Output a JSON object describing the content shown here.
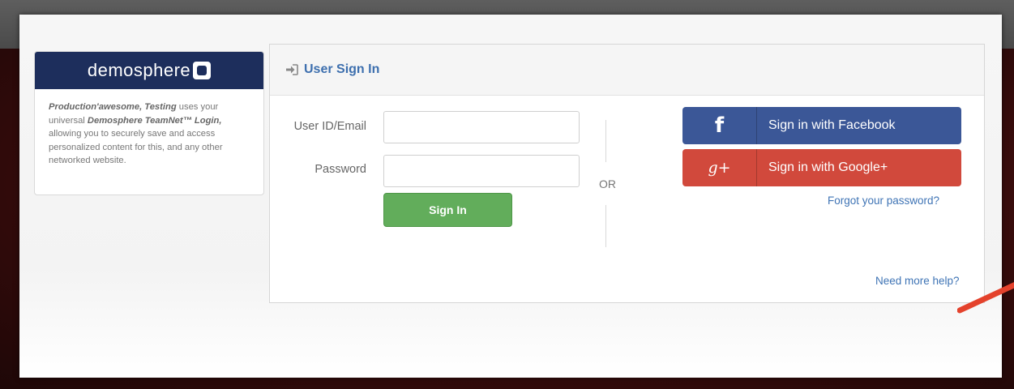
{
  "brand": {
    "name": "demosphere",
    "description_html": "<b>Production'awesome, Testing</b> uses your universal <b>Demosphere TeamNet™ Login,</b> allowing you to securely save and access personalized content for this, and any other networked website."
  },
  "signin": {
    "title": "User Sign In",
    "user_label": "User ID/Email",
    "user_value": "",
    "password_label": "Password",
    "password_value": "",
    "submit_label": "Sign In",
    "or_text": "OR"
  },
  "social": {
    "facebook_label": "Sign in with Facebook",
    "google_label": "Sign in with Google+",
    "facebook_icon": "f",
    "google_icon": "g+"
  },
  "links": {
    "forgot_password": "Forgot your password?",
    "need_help": "Need more help?"
  },
  "colors": {
    "brand_navy": "#1d2e5c",
    "facebook": "#3b5797",
    "google": "#d1493c",
    "signin_green": "#62ad5b",
    "link_blue": "#3f74b5",
    "arrow": "#e4422c"
  }
}
